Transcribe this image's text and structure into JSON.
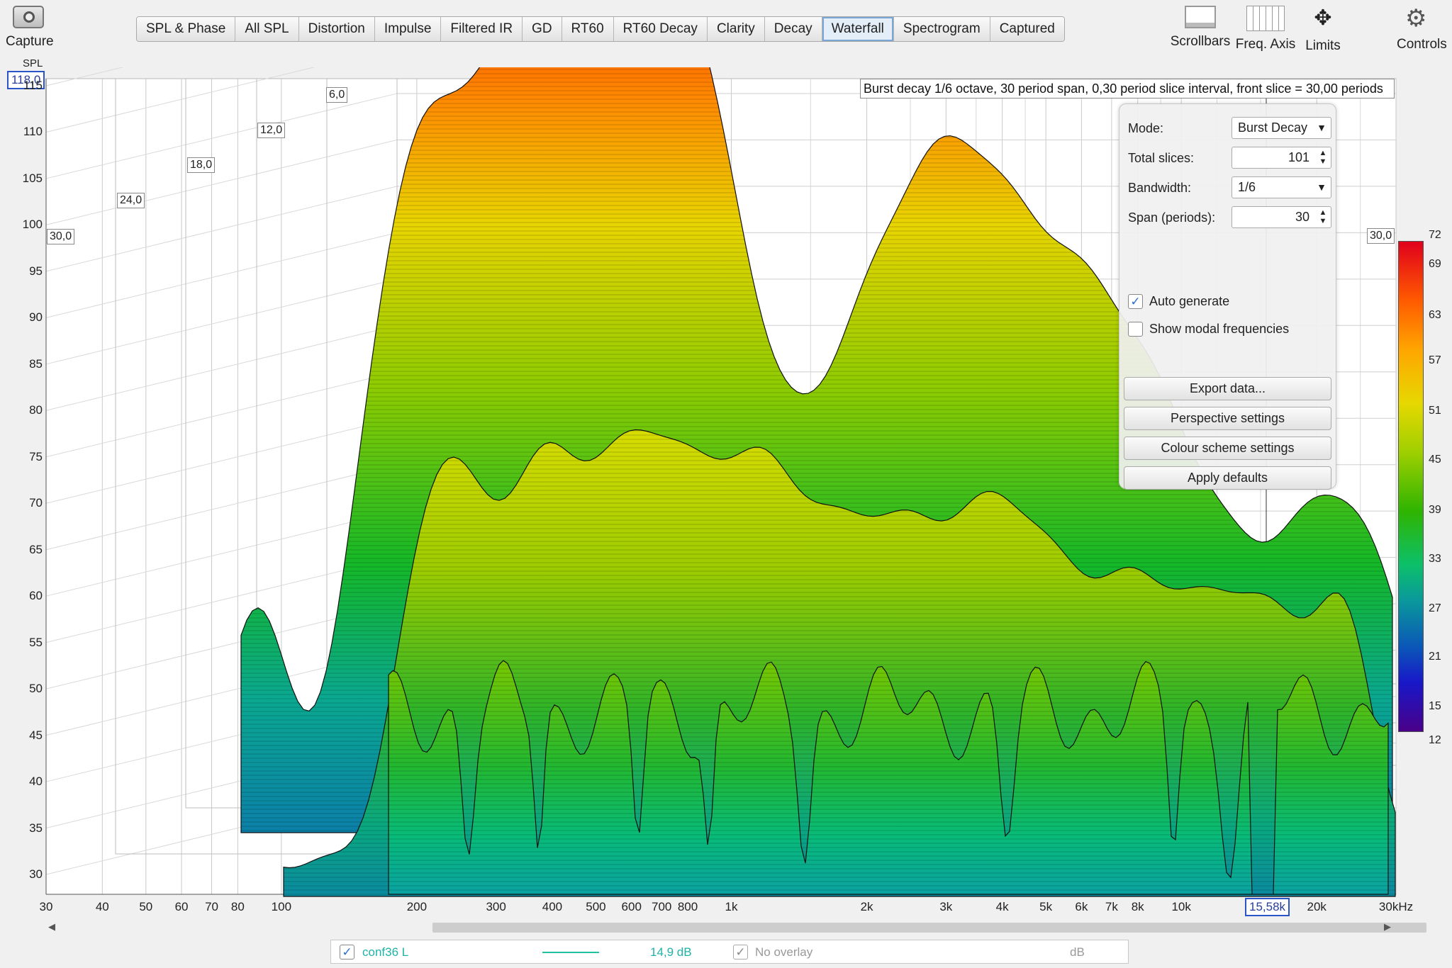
{
  "toolbar": {
    "capture": "Capture",
    "scrollbars": "Scrollbars",
    "freq_axis": "Freq. Axis",
    "limits": "Limits",
    "controls": "Controls"
  },
  "tabs": [
    {
      "label": "SPL & Phase",
      "active": false
    },
    {
      "label": "All SPL",
      "active": false
    },
    {
      "label": "Distortion",
      "active": false
    },
    {
      "label": "Impulse",
      "active": false
    },
    {
      "label": "Filtered IR",
      "active": false
    },
    {
      "label": "GD",
      "active": false
    },
    {
      "label": "RT60",
      "active": false
    },
    {
      "label": "RT60 Decay",
      "active": false
    },
    {
      "label": "Clarity",
      "active": false
    },
    {
      "label": "Decay",
      "active": false
    },
    {
      "label": "Waterfall",
      "active": true
    },
    {
      "label": "Spectrogram",
      "active": false
    },
    {
      "label": "Captured",
      "active": false
    }
  ],
  "plot": {
    "y_axis_title": "SPL",
    "y_max_box": "118,0",
    "info": "Burst decay 1/6 octave, 30 period span, 0,30 period slice interval,  front slice = 30,00 periods",
    "cursor_freq": "15,58k",
    "right_period_box": "30,0"
  },
  "chart_data": {
    "type": "waterfall",
    "ylabel": "SPL",
    "y_ticks": [
      "115",
      "110",
      "105",
      "100",
      "95",
      "90",
      "85",
      "80",
      "75",
      "70",
      "65",
      "60",
      "55",
      "50",
      "45",
      "40",
      "35",
      "30"
    ],
    "x_ticks": [
      "30",
      "40",
      "50",
      "60",
      "70",
      "80",
      "100",
      "200",
      "300",
      "400",
      "500",
      "600",
      "700",
      "800",
      "1k",
      "2k",
      "3k",
      "4k",
      "5k",
      "6k",
      "7k",
      "8k",
      "10k",
      "20k",
      "30kHz"
    ],
    "period_ticks": [
      "6,0",
      "12,0",
      "18,0",
      "24,0",
      "30,0"
    ],
    "colour_scale": [
      "72",
      "69",
      "63",
      "57",
      "51",
      "45",
      "39",
      "33",
      "27",
      "21",
      "15",
      "12"
    ],
    "ylim": [
      30,
      118
    ],
    "xlim": [
      30,
      30000
    ],
    "log_x": true
  },
  "controls_panel": {
    "mode_label": "Mode:",
    "mode_value": "Burst Decay",
    "slices_label": "Total slices:",
    "slices_value": "101",
    "bandwidth_label": "Bandwidth:",
    "bandwidth_value": "1/6",
    "span_label": "Span (periods):",
    "span_value": "30",
    "auto_generate": "Auto generate",
    "auto_generate_checked": true,
    "show_modal": "Show modal frequencies",
    "show_modal_checked": false,
    "export_btn": "Export data...",
    "perspective_btn": "Perspective settings",
    "colour_btn": "Colour scheme settings",
    "defaults_btn": "Apply defaults"
  },
  "legend": {
    "name": "conf36 L",
    "value": "14,9 dB",
    "overlay": "No overlay",
    "unit": "dB"
  }
}
